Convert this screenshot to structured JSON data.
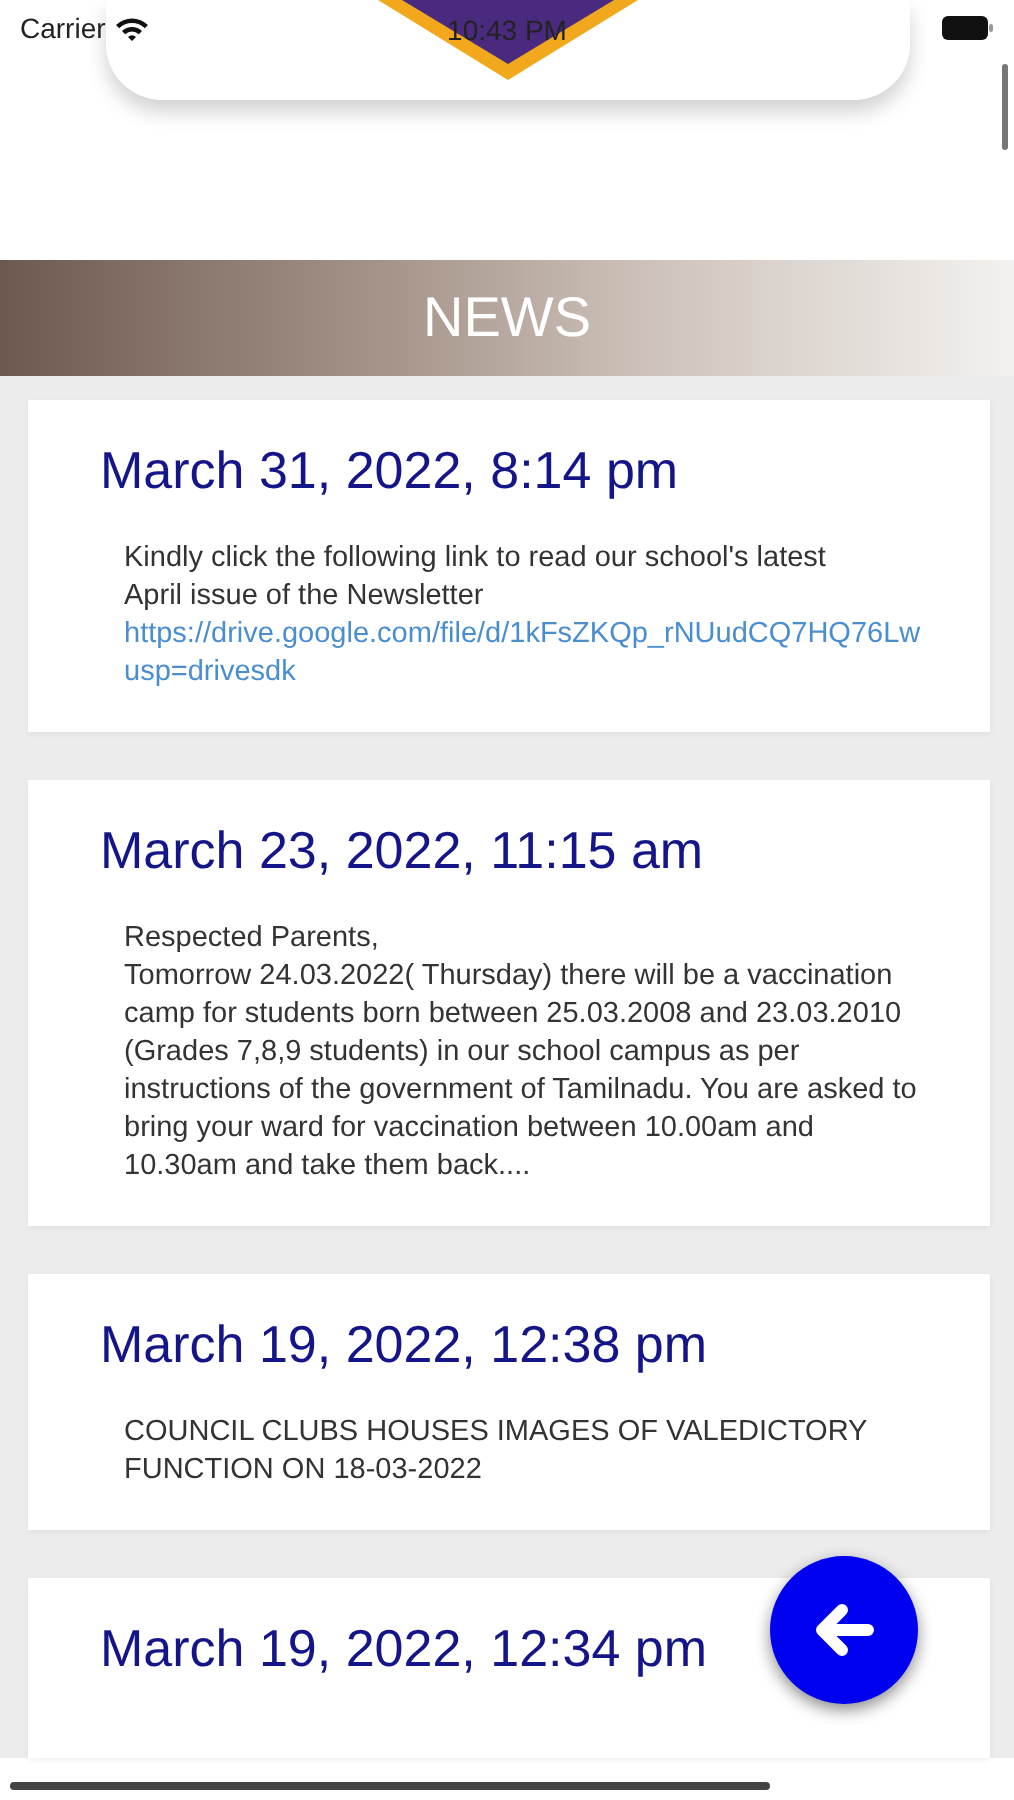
{
  "status_bar": {
    "carrier": "Carrier",
    "time": "10:43 PM"
  },
  "banner": {
    "title": "NEWS"
  },
  "news": [
    {
      "date": "March 31, 2022, 8:14 pm",
      "body": [
        "Kindly click the following link to read our school's latest",
        "April issue of the Newsletter"
      ],
      "link": [
        "https://drive.google.com/file/d/1kFsZKQp_rNUudCQ7HQ76Lw",
        "usp=drivesdk"
      ]
    },
    {
      "date": "March 23, 2022, 11:15 am",
      "body": [
        "Respected Parents,",
        "Tomorrow 24.03.2022( Thursday) there will be a vaccination camp for students born between 25.03.2008 and 23.03.2010 (Grades 7,8,9 students) in our school campus as per instructions of the government of Tamilnadu. You are asked to bring your ward for vaccination between 10.00am and 10.30am and take them back...."
      ]
    },
    {
      "date": "March 19, 2022, 12:38 pm",
      "body": [
        "COUNCIL CLUBS HOUSES IMAGES OF VALEDICTORY FUNCTION ON 18-03-2022"
      ]
    },
    {
      "date": "March 19, 2022, 12:34 pm"
    }
  ]
}
